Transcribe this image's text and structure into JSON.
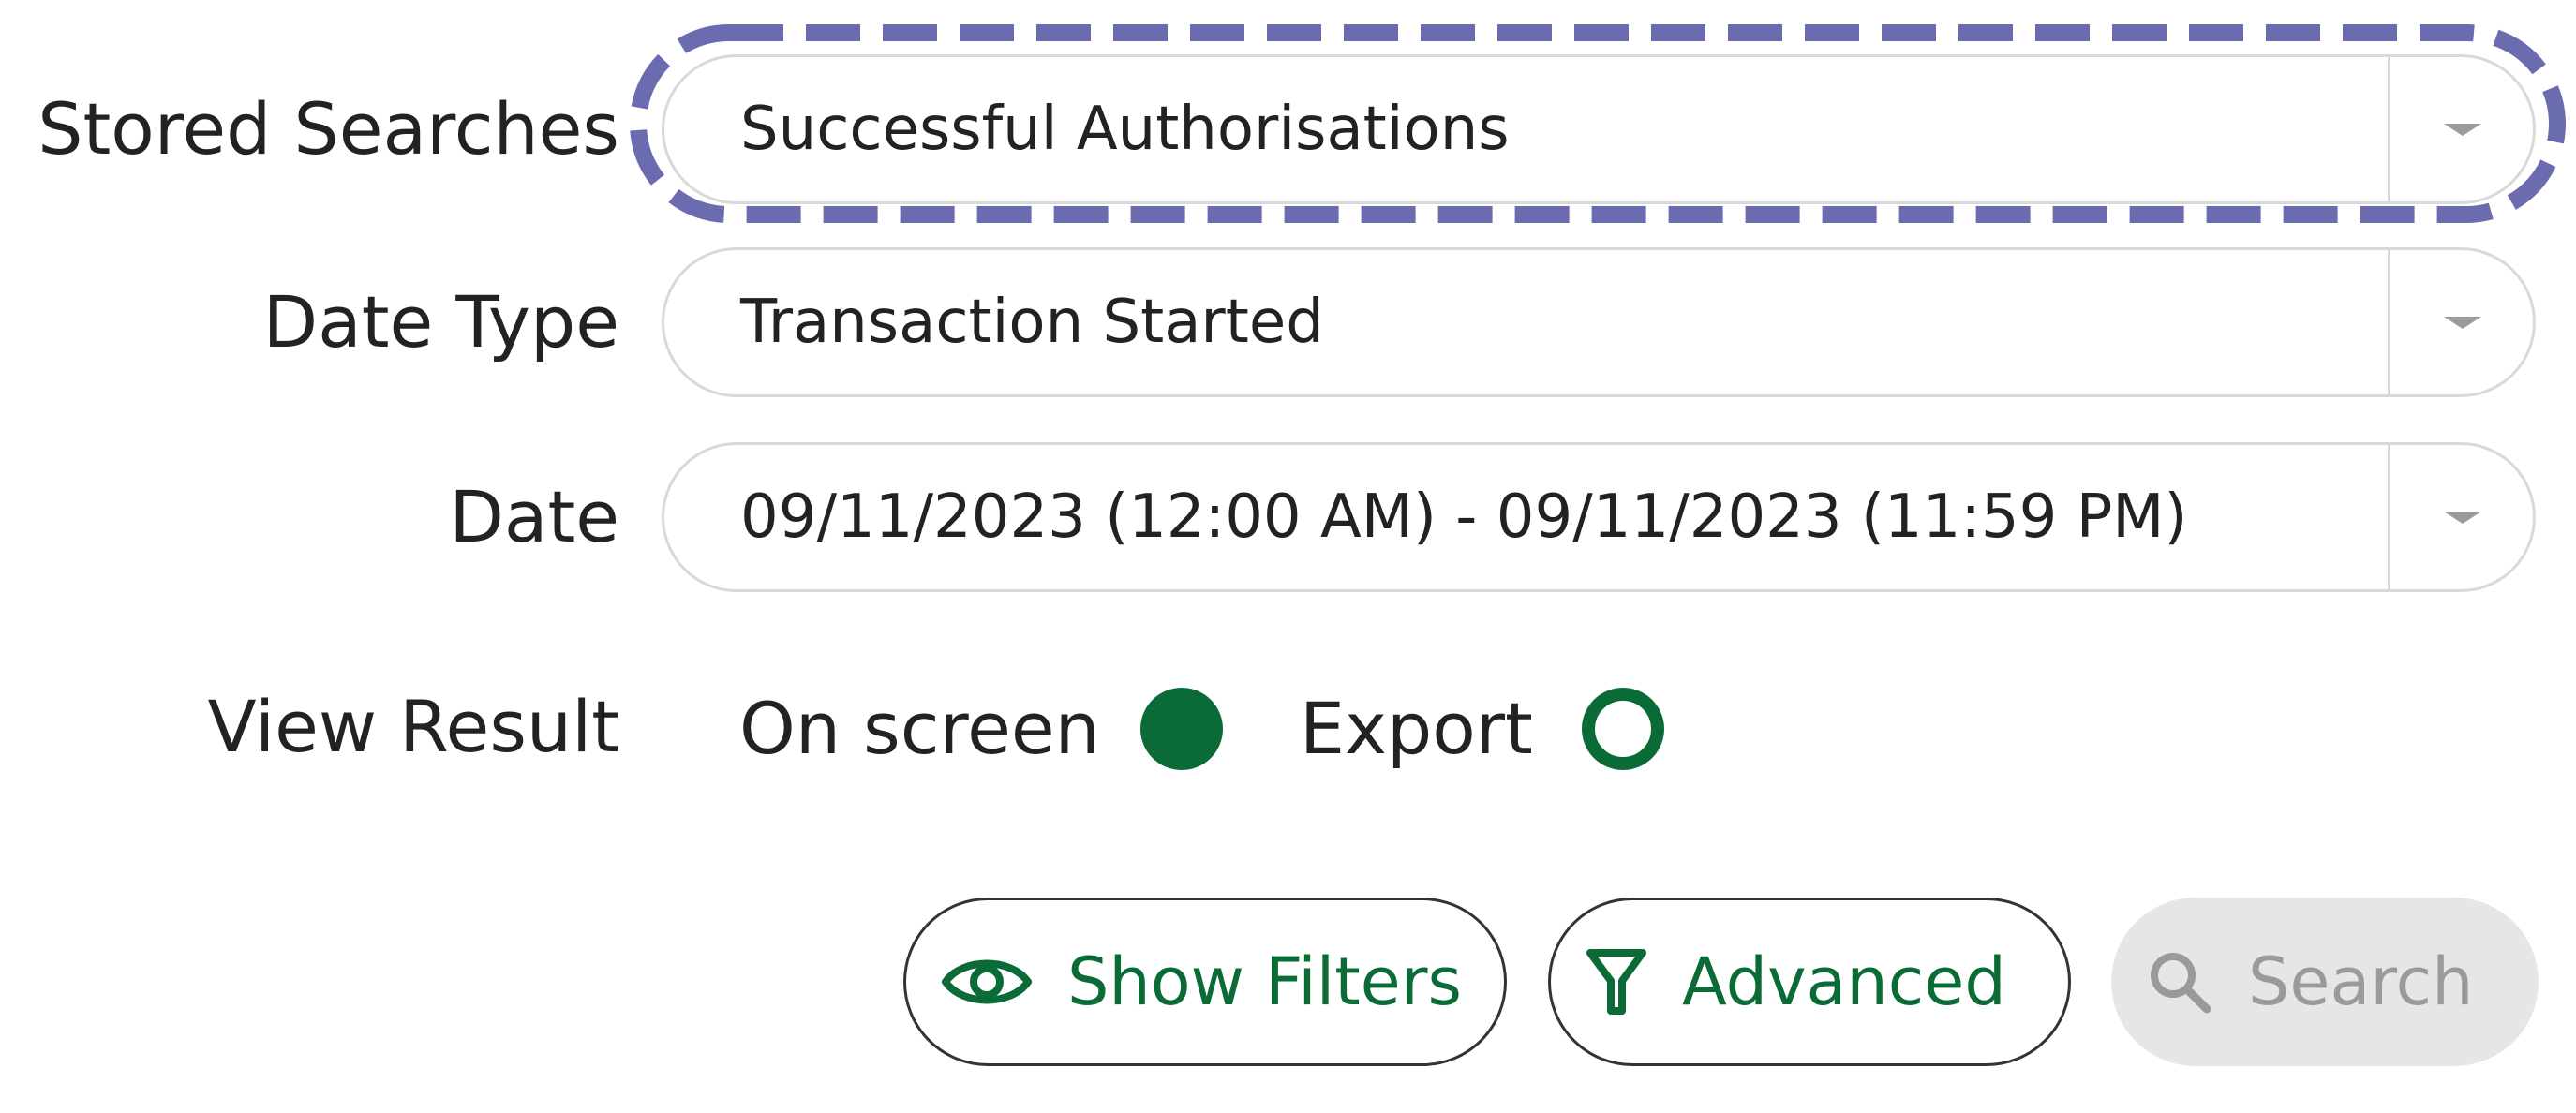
{
  "form": {
    "stored_searches": {
      "label": "Stored Searches",
      "value": "Successful Authorisations",
      "highlighted": true
    },
    "date_type": {
      "label": "Date Type",
      "value": "Transaction Started"
    },
    "date": {
      "label": "Date",
      "value": "09/11/2023 (12:00 AM) - 09/11/2023 (11:59 PM)"
    },
    "view_result": {
      "label": "View Result",
      "options": [
        {
          "label": "On screen",
          "selected": true
        },
        {
          "label": "Export",
          "selected": false
        }
      ]
    }
  },
  "actions": {
    "show_filters": {
      "label": "Show Filters",
      "icon": "eye-icon"
    },
    "advanced": {
      "label": "Advanced",
      "icon": "filter-icon"
    },
    "search": {
      "label": "Search",
      "icon": "search-icon",
      "disabled": true
    }
  },
  "colors": {
    "accent_green": "#0a6b37",
    "highlight_dash": "#6b6bb0",
    "border_gray": "#d9d9d9",
    "disabled_bg": "#e6e6e6",
    "disabled_text": "#9a9a9a"
  }
}
